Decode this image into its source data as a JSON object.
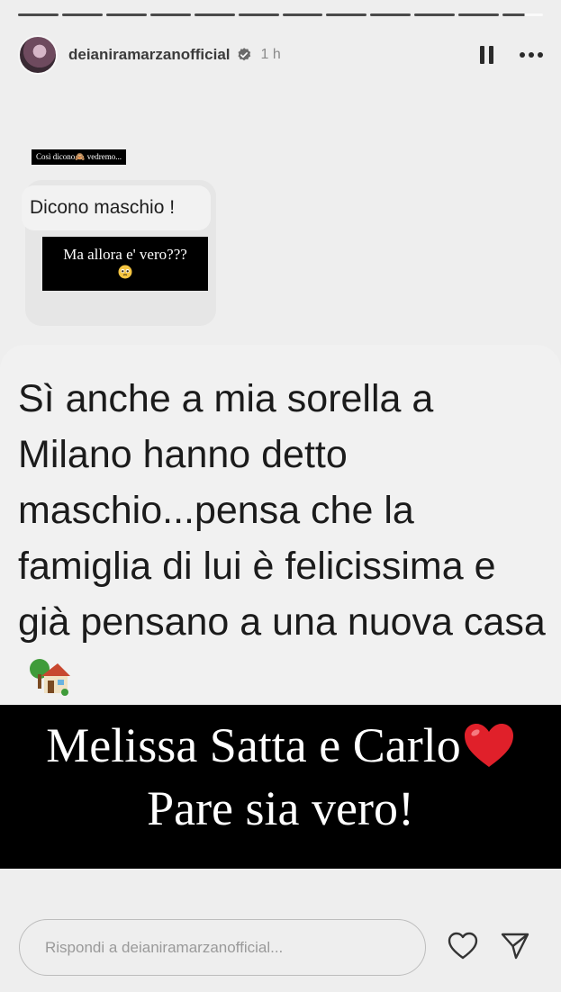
{
  "story": {
    "segments": [
      "done",
      "done",
      "done",
      "done",
      "done",
      "done",
      "done",
      "done",
      "done",
      "done",
      "done",
      "active"
    ],
    "user": {
      "username": "deianiramarzanofficial",
      "time": "1 h",
      "verified": true
    },
    "screenshot": {
      "tag": "Così dicono🙈 vedremo...",
      "question": "Dicono maschio !",
      "caption": "Ma allora e' vero???"
    },
    "answer": {
      "text": "Sì anche a mia sorella a Milano hanno detto maschio...pensa che la famiglia di lui è felicissima e già pensano a una nuova casa"
    },
    "banner": {
      "line1": "Melissa Satta e Carlo",
      "line2": "Pare sia vero!"
    },
    "reply": {
      "placeholder": "Rispondi a deianiramarzanofficial..."
    }
  },
  "colors": {
    "background": "#eeeeee",
    "banner": "#000000",
    "heart": "#e0202a"
  },
  "icons": [
    "verified-badge-icon",
    "pause-icon",
    "more-icon",
    "house-emoji-icon",
    "heart-emoji-icon",
    "like-icon",
    "send-icon",
    "pleading-face-icon"
  ]
}
